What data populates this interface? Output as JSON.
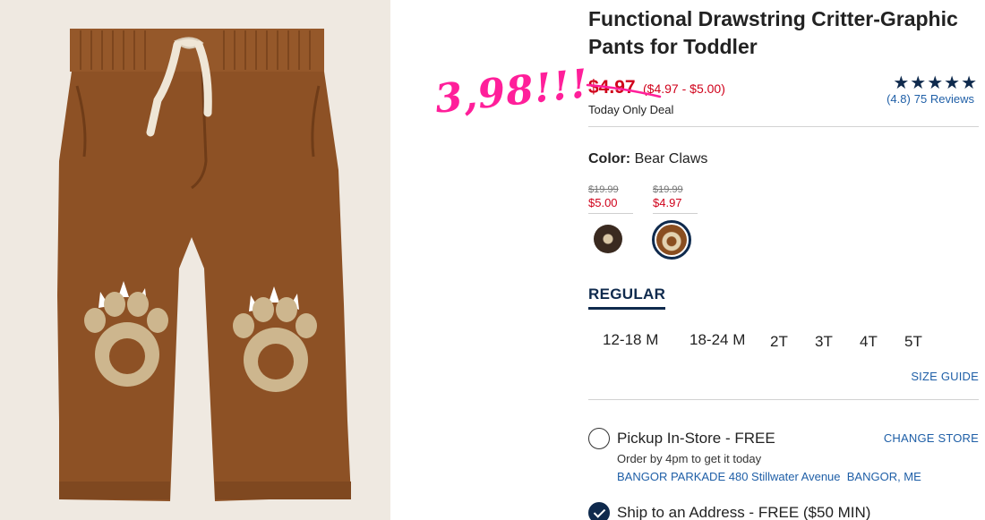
{
  "product": {
    "title_line1": "Functional Drawstring Critter-Graphic",
    "title_line2": "Pants for Toddler"
  },
  "annotation": {
    "text": "3,98!!!",
    "color": "#ff1f9a"
  },
  "price": {
    "sale": "$4.97",
    "range": "($4.97 - $5.00)",
    "deal_label": "Today Only Deal",
    "color": "#d0021b"
  },
  "rating": {
    "stars": "★★★★★",
    "value": 4.8,
    "score_text": "(4.8)",
    "reviews_text": "75 Reviews"
  },
  "color_selector": {
    "label": "Color:",
    "value": "Bear Claws",
    "swatches": [
      {
        "was": "$19.99",
        "now": "$5.00",
        "name": "dark-bear-swatch",
        "selected": false,
        "color": "#3a2a20"
      },
      {
        "was": "$19.99",
        "now": "$4.97",
        "name": "bear-claws-swatch",
        "selected": true,
        "color": "#8a4e20"
      }
    ]
  },
  "fit": {
    "tab": "REGULAR"
  },
  "sizes": [
    "12-18 M",
    "18-24 M",
    "2T",
    "3T",
    "4T",
    "5T"
  ],
  "size_guide": "SIZE GUIDE",
  "fulfillment": {
    "pickup": {
      "title": "Pickup In-Store - FREE",
      "sub": "Order by 4pm to get it today",
      "store": "BANGOR PARKADE 480 Stillwater Avenue  BANGOR, ME",
      "change": "CHANGE STORE",
      "selected": false
    },
    "ship": {
      "title": "Ship to an Address - FREE ($50 MIN)",
      "selected": true
    }
  },
  "colors": {
    "navy": "#0f2a4d",
    "link": "#1f5fa7",
    "sale_red": "#d0021b",
    "pants_brown": "#8a4e20",
    "image_bg": "#efe9e1"
  }
}
